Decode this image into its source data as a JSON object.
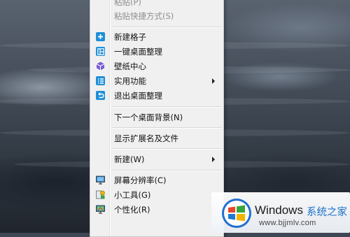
{
  "context_menu": {
    "items": [
      {
        "label": "粘贴(P)",
        "disabled": true,
        "icon": null,
        "submenu": false
      },
      {
        "label": "粘贴快捷方式(S)",
        "disabled": true,
        "icon": null,
        "submenu": false
      },
      {
        "label": "新建格子",
        "disabled": false,
        "icon": "plus-icon",
        "submenu": false
      },
      {
        "label": "一键桌面整理",
        "disabled": false,
        "icon": "grid-layout-icon",
        "submenu": false
      },
      {
        "label": "壁纸中心",
        "disabled": false,
        "icon": "cube-icon",
        "submenu": false
      },
      {
        "label": "实用功能",
        "disabled": false,
        "icon": "list-icon",
        "submenu": true
      },
      {
        "label": "退出桌面整理",
        "disabled": false,
        "icon": "exit-icon",
        "submenu": false
      },
      {
        "label": "下一个桌面背景(N)",
        "disabled": false,
        "icon": null,
        "submenu": false
      },
      {
        "label": "显示扩展名及文件",
        "disabled": false,
        "icon": null,
        "submenu": false
      },
      {
        "label": "新建(W)",
        "disabled": false,
        "icon": null,
        "submenu": true
      },
      {
        "label": "屏幕分辨率(C)",
        "disabled": false,
        "icon": "monitor-icon",
        "submenu": false
      },
      {
        "label": "小工具(G)",
        "disabled": false,
        "icon": "gadgets-icon",
        "submenu": false
      },
      {
        "label": "个性化(R)",
        "disabled": false,
        "icon": "personalize-icon",
        "submenu": false
      }
    ]
  },
  "watermark": {
    "brand": "Windows",
    "tagline": "系统之家",
    "url": "www.bjjmlv.com"
  },
  "colors": {
    "menu_bg": "#f0f0f0",
    "icon_blue": "#1e8fd8",
    "icon_purple": "#7b5bd6",
    "disabled_text": "#8e8e8e",
    "brand_blue": "#1e73c9"
  }
}
